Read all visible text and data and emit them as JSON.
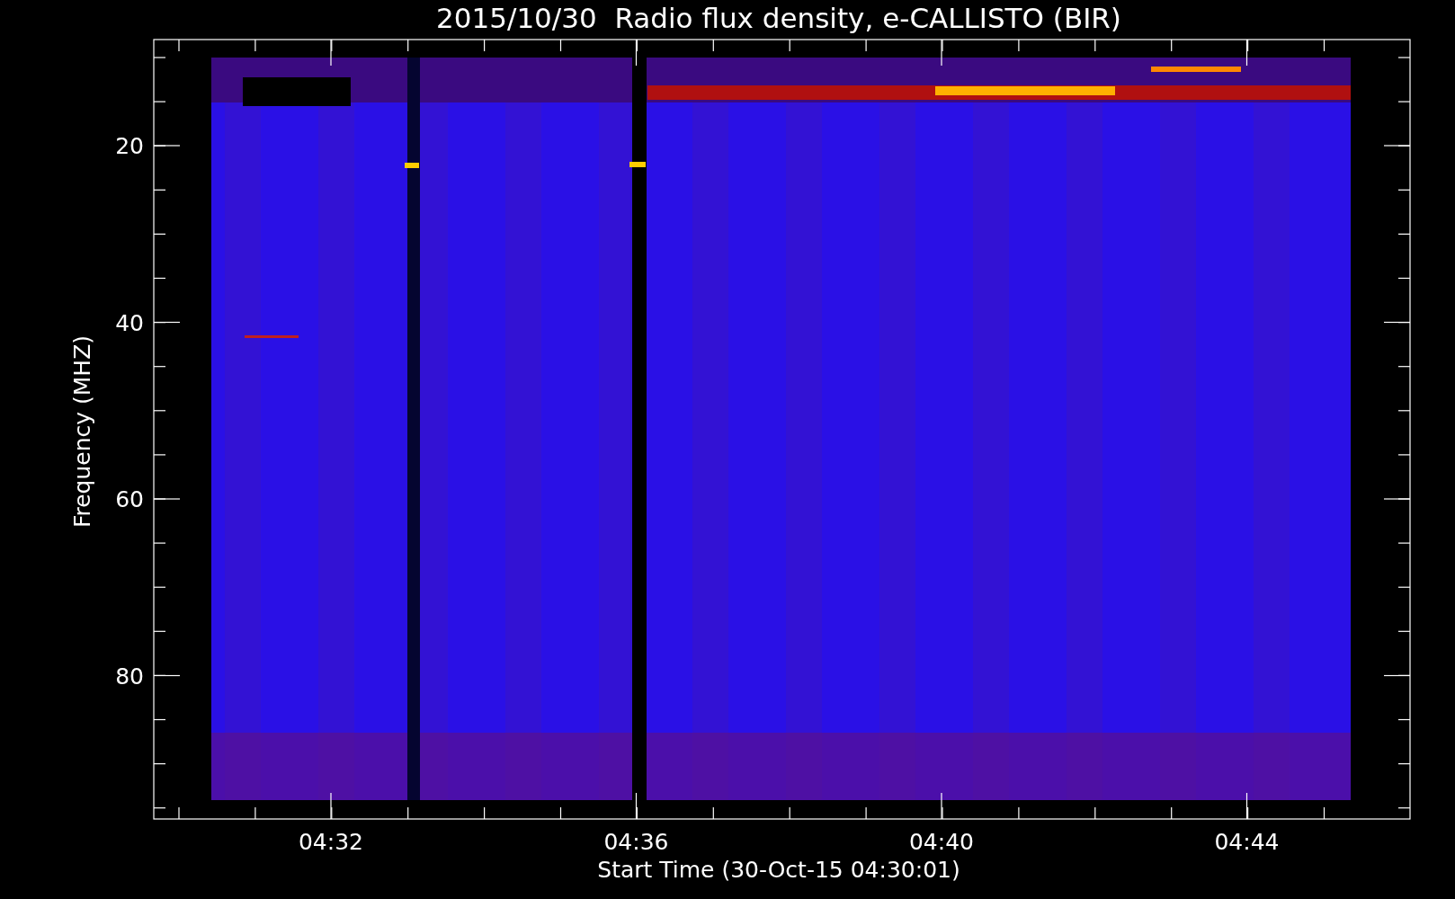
{
  "title": "2015/10/30  Radio flux density, e-CALLISTO (BIR)",
  "y_axis": {
    "label": "Frequency (MHZ)",
    "ticks": [
      "20",
      "40",
      "60",
      "80"
    ]
  },
  "x_axis": {
    "label": "Start Time (30-Oct-15 04:30:01)",
    "ticks": [
      "04:32",
      "04:36",
      "04:40",
      "04:44"
    ]
  }
}
